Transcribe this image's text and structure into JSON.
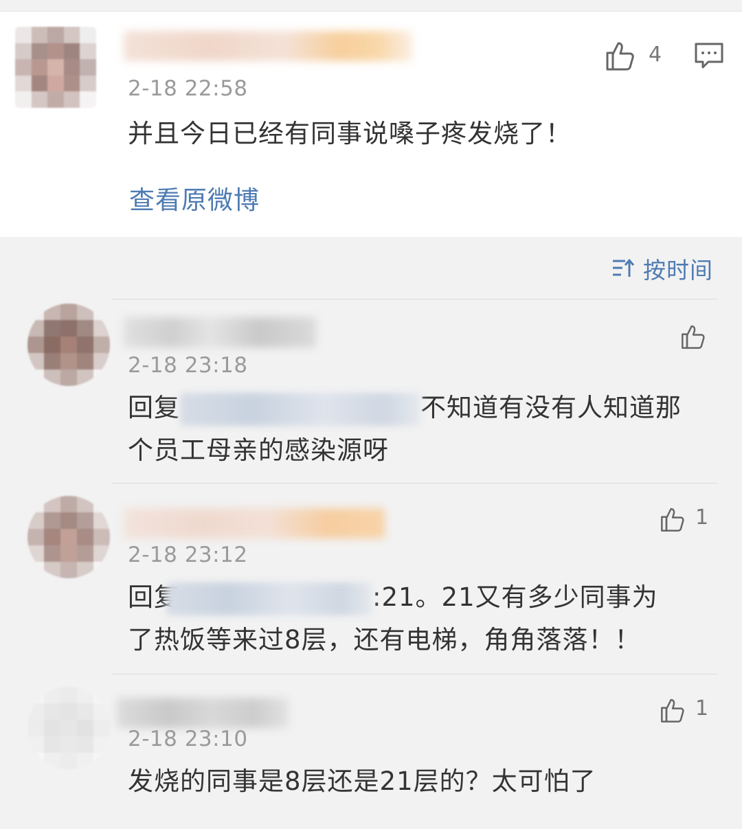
{
  "main_post": {
    "like_count": "4",
    "time": "2-18 22:58",
    "text": "并且今日已经有同事说嗓子疼发烧了！",
    "view_original_link": "查看原微博"
  },
  "sort": {
    "label": "按时间"
  },
  "comments": [
    {
      "time": "2-18 23:18",
      "reply_prefix": "回复",
      "text_line1": "不知道有没有人知道那",
      "text_line2": "个员工母亲的感染源呀",
      "like_count": ""
    },
    {
      "time": "2-18 23:12",
      "reply_prefix": "回复",
      "text_line1": ":21。21又有多少同事为",
      "text_line2": "了热饭等来过8层，还有电梯，角角落落！！",
      "like_count": "1"
    },
    {
      "time": "2-18 23:10",
      "text_line1": "发烧的同事是8层还是21层的？太可怕了",
      "like_count": "1"
    }
  ],
  "icons": {
    "like": "thumbs-up-icon",
    "comment": "comment-bubble-icon",
    "sort": "sort-icon"
  },
  "colors": {
    "link": "#4e7bb2",
    "time": "#9a9a9a",
    "text": "#333333",
    "background": "#f2f2f2"
  }
}
